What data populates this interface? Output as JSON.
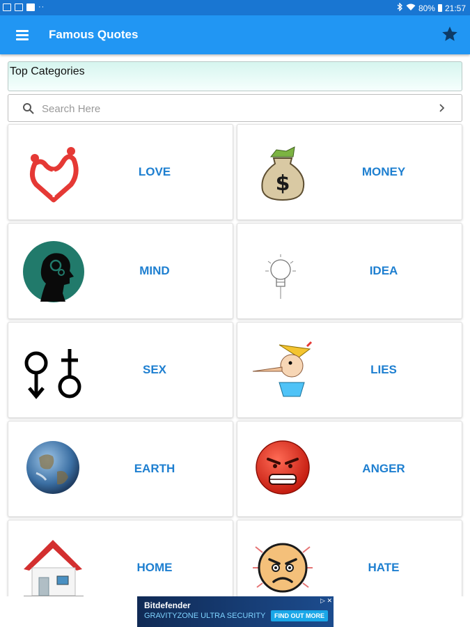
{
  "status_bar": {
    "left_icons": [
      "image-icon",
      "video-icon",
      "flipboard-icon",
      "more-dots-icon"
    ],
    "dots": "··",
    "right_icons": [
      "bluetooth-icon",
      "wifi-icon"
    ],
    "battery": "80%",
    "time": "21:57"
  },
  "app_bar": {
    "title": "Famous Quotes",
    "menu_icon": "menu-icon",
    "favorite_icon": "star-icon",
    "color": "#2196f3"
  },
  "section": {
    "header": "Top Categories"
  },
  "search": {
    "placeholder": "Search Here"
  },
  "categories": [
    {
      "label": "LOVE",
      "icon": "love-couple-heart-icon"
    },
    {
      "label": "MONEY",
      "icon": "money-bag-icon"
    },
    {
      "label": "MIND",
      "icon": "mind-head-gears-icon"
    },
    {
      "label": "IDEA",
      "icon": "lightbulb-sketch-icon"
    },
    {
      "label": "SEX",
      "icon": "gender-symbols-icon"
    },
    {
      "label": "LIES",
      "icon": "pinocchio-icon"
    },
    {
      "label": "EARTH",
      "icon": "earth-globe-icon"
    },
    {
      "label": "ANGER",
      "icon": "angry-face-icon"
    },
    {
      "label": "HOME",
      "icon": "house-icon"
    },
    {
      "label": "HATE",
      "icon": "hate-face-icon"
    }
  ],
  "label_color": "#1e7fd0",
  "ad": {
    "brand": "Bitdefender",
    "product": "GRAVITYZONE ULTRA SECURITY",
    "cta": "FIND OUT MORE",
    "close": "▷ ✕"
  }
}
